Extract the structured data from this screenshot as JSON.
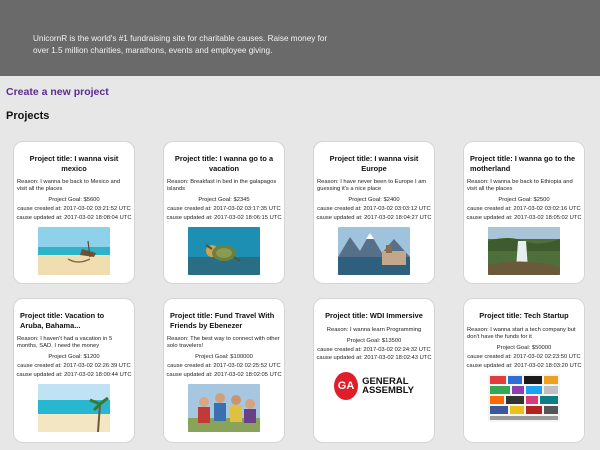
{
  "hero": {
    "text": "UnicornR is the world's #1 fundraising site for charitable causes. Raise money for over 1.5 million charities, marathons, events and employee giving."
  },
  "create_link": "Create a new project",
  "section_title": "Projects",
  "projects": [
    {
      "title": "Project title: I wanna visit mexico",
      "reason": "Reason: I wanna be back to Mexico and visit all the places",
      "goal": "Project Goal: $5600",
      "created": "cause created at: 2017-03-02 03:21:52 UTC",
      "updated": "cause updated at: 2017-03-02 18:08:04 UTC",
      "image": "beach-hammock-photo"
    },
    {
      "title": "Project title: I wanna go to a vacation",
      "reason": "Reason: Breakfast in bed in the galapagos islands",
      "goal": "Project Goal: $2345",
      "created": "cause created at: 2017-03-02 03:17:35 UTC",
      "updated": "cause updated at: 2017-03-02 18:06:15 UTC",
      "image": "sea-turtle-photo"
    },
    {
      "title": "Project title: I wanna visit Europe",
      "reason": "Reason: I have never been to Europe I am guessing it's a nice place",
      "goal": "Project Goal: $2400",
      "created": "cause created at: 2017-03-02 03:03:12 UTC",
      "updated": "cause updated at: 2017-03-02 18:04:27 UTC",
      "image": "alpine-lake-village-photo"
    },
    {
      "title": "Project title: I wanna go to the motherland",
      "reason": "Reason: I wanna be back to Ethiopia and visit all the places",
      "goal": "Project Goal: $2500",
      "created": "cause created at: 2017-03-02 03:02:16 UTC",
      "updated": "cause updated at: 2017-03-02 18:05:02 UTC",
      "image": "waterfall-photo"
    },
    {
      "title": "Project title: Vacation to Aruba, Bahama...",
      "reason": "Reason: I haven't had a vacation in 5 months, SAD. I need the money",
      "goal": "Project Goal: $1200",
      "created": "cause created at: 2017-03-02 02:26:39 UTC",
      "updated": "cause updated at: 2017-03-02 18:00:44 UTC",
      "image": "tropical-beach-photo"
    },
    {
      "title": "Project title: Fund Travel With Friends by Ebenezer",
      "reason": "Reason: The best way to connect with other solo travelers!",
      "goal": "Project Goal: $100000",
      "created": "cause created at: 2017-03-02 02:25:52 UTC",
      "updated": "cause updated at: 2017-03-02 18:02:05 UTC",
      "image": "friends-group-photo"
    },
    {
      "title": "Project title: WDI Immersive",
      "reason": "Reason: I wanna learn Programming",
      "goal": "Project Goal: $13500",
      "created": "cause created at: 2017-03-02 02:24:32 UTC",
      "updated": "cause updated at: 2017-03-02 18:02:43 UTC",
      "image": "general-assembly-logo",
      "logo_mark": "GA",
      "logo_word_1": "GENERAL",
      "logo_word_2": "ASSEMBLY"
    },
    {
      "title": "Project title: Tech Startup",
      "reason": "Reason: I wanna start a tech company but don't have the funds for it",
      "goal": "Project Goal: $50000",
      "created": "cause created at: 2017-03-02 02:23:50 UTC",
      "updated": "cause updated at: 2017-03-02 18:03:20 UTC",
      "image": "startup-logos-collage"
    }
  ]
}
